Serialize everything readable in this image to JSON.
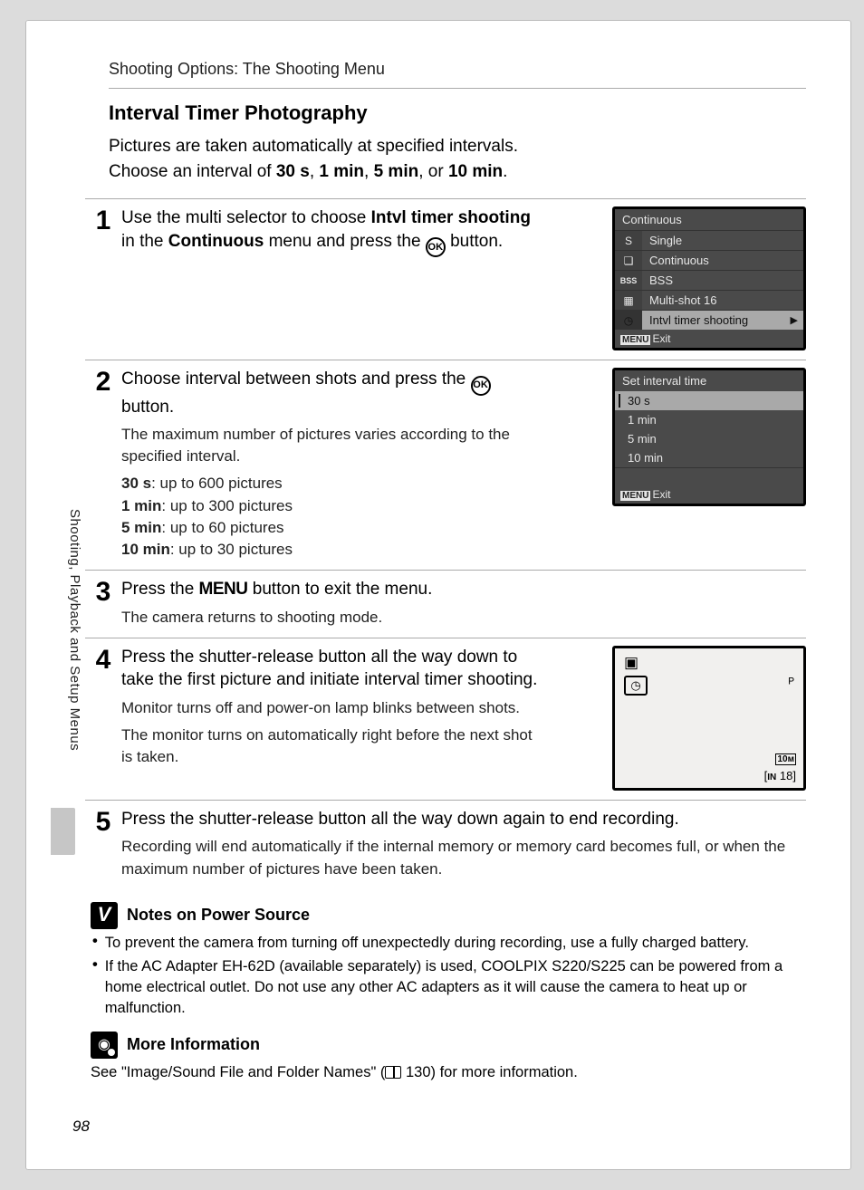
{
  "header": "Shooting Options: The Shooting Menu",
  "sidebar_label": "Shooting, Playback and Setup Menus",
  "title": "Interval Timer Photography",
  "intro_line1": "Pictures are taken automatically at specified intervals.",
  "intro_prefix": "Choose an interval of ",
  "intro_b1": "30 s",
  "intro_c1": ", ",
  "intro_b2": "1 min",
  "intro_c2": ", ",
  "intro_b3": "5 min",
  "intro_c3": ", or ",
  "intro_b4": "10 min",
  "intro_suffix": ".",
  "ok_label": "OK",
  "steps": {
    "s1": {
      "num": "1",
      "t_a": "Use the multi selector to choose ",
      "t_b1": "Intvl timer shooting",
      "t_c1": " in the ",
      "t_b2": "Continuous",
      "t_c2": " menu and press the ",
      "t_c3": " button."
    },
    "s2": {
      "num": "2",
      "t_a": "Choose interval between shots and press the ",
      "t_b": " button.",
      "sub1": "The maximum number of pictures varies according to the specified interval.",
      "b1k": "30 s",
      "b1v": ": up to 600 pictures",
      "b2k": "1 min",
      "b2v": ": up to 300 pictures",
      "b3k": "5 min",
      "b3v": ": up to 60 pictures",
      "b4k": "10 min",
      "b4v": ": up to 30 pictures"
    },
    "s3": {
      "num": "3",
      "t_a": "Press the ",
      "t_menu": "MENU",
      "t_b": " button to exit the menu.",
      "sub": "The camera returns to shooting mode."
    },
    "s4": {
      "num": "4",
      "title": "Press the shutter-release button all the way down to take the first picture and initiate interval timer shooting.",
      "sub1": "Monitor turns off and power-on lamp blinks between shots.",
      "sub2": "The monitor turns on automatically right before the next shot is taken."
    },
    "s5": {
      "num": "5",
      "title": "Press the shutter-release button all the way down again to end recording.",
      "sub": "Recording will end automatically if the internal memory or memory card becomes full, or when the maximum number of pictures have been taken."
    }
  },
  "screen1": {
    "title": "Continuous",
    "items": [
      {
        "icon": "S",
        "label": "Single"
      },
      {
        "icon": "❏",
        "label": "Continuous"
      },
      {
        "icon": "BSS",
        "label": "BSS"
      },
      {
        "icon": "▦",
        "label": "Multi-shot 16"
      },
      {
        "icon": "◷",
        "label": "Intvl timer shooting",
        "selected": true,
        "arrow": "▶"
      }
    ],
    "foot_menu": "MENU",
    "foot_exit": "Exit"
  },
  "screen2": {
    "title": "Set interval time",
    "items": [
      {
        "label": "30 s",
        "selected": true
      },
      {
        "label": "  1 min"
      },
      {
        "label": "  5 min"
      },
      {
        "label": "10 min"
      }
    ],
    "foot_menu": "MENU",
    "foot_exit": "Exit"
  },
  "shoot": {
    "cam": "▣",
    "timer": "◷",
    "tr": "ᴾ",
    "br1_unit": "10ᴍ",
    "br2_in": "IN",
    "br2_val": "18"
  },
  "note1": {
    "icon": "V",
    "title": "Notes on Power Source",
    "li1": "To prevent the camera from turning off unexpectedly during recording, use a fully charged battery.",
    "li2": "If the AC Adapter EH-62D (available separately) is used, COOLPIX S220/S225 can be powered from a home electrical outlet. Do not use any other AC adapters as it will cause the camera to heat up or malfunction."
  },
  "note2": {
    "icon": "◉",
    "title": "More Information",
    "text_a": "See \"Image/Sound File and Folder Names\" (",
    "ref": "130",
    "text_b": ") for more information."
  },
  "page_number": "98"
}
